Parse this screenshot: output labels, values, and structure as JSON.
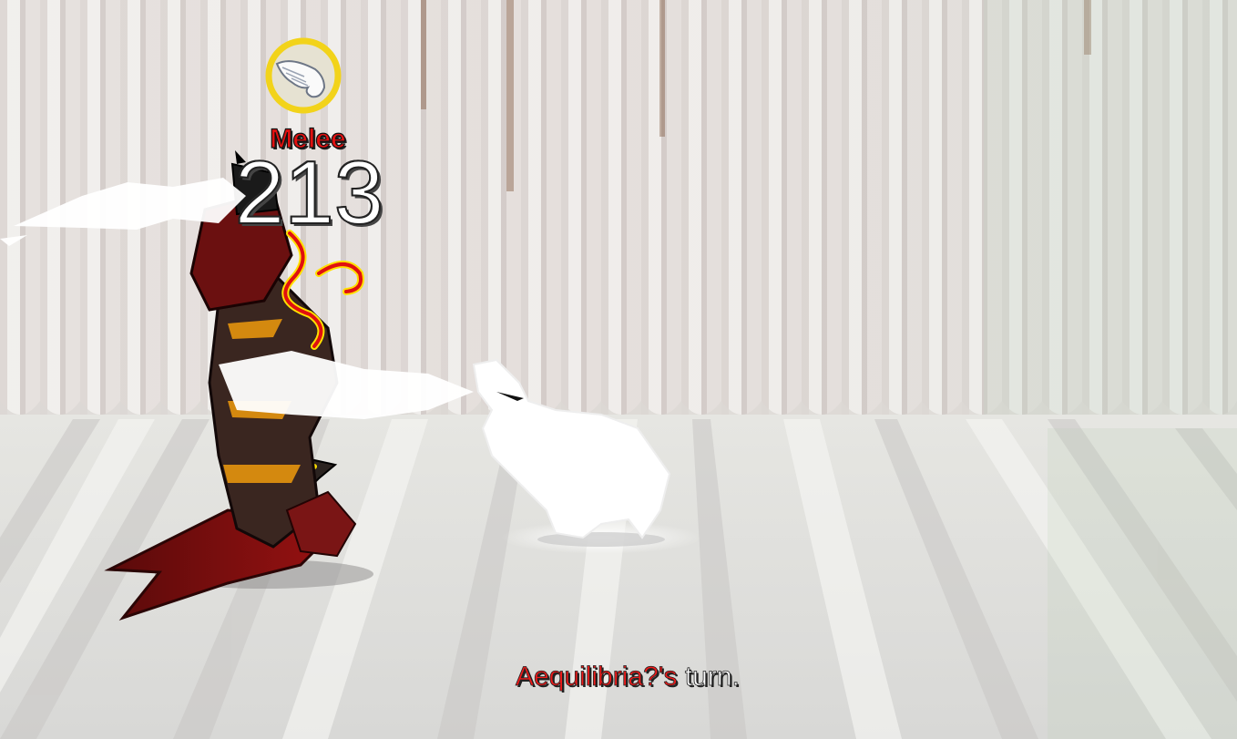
{
  "hud": {
    "attack_type": "Melee",
    "damage": "213",
    "turn_player_name": "Aequilibria?'s",
    "turn_suffix": " turn."
  },
  "icons": {
    "attack_icon": "winged-melee-icon"
  },
  "colors": {
    "attack_type": "#e11010",
    "turn_player_name": "#ee1a1a",
    "damage": "#ffffff",
    "icon_ring": "#f2d31a"
  }
}
